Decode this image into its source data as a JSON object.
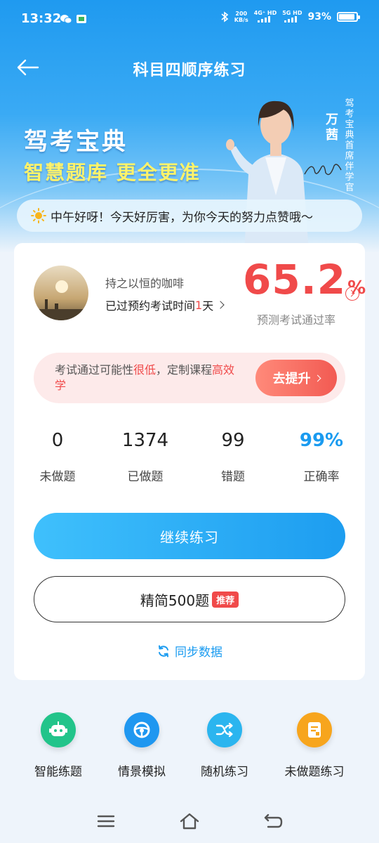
{
  "status_bar": {
    "time": "13:32",
    "net_speed_top": "200",
    "net_speed_bottom": "KB/s",
    "sig1": "4G⁺ HD",
    "sig2": "5G HD",
    "battery": "93%"
  },
  "header": {
    "title": "科目四顺序练习"
  },
  "banner": {
    "title": "驾考宝典",
    "subtitle": "智慧题库 更全更准",
    "coach_name": "万茜",
    "coach_title": "驾考宝典首席伴学官"
  },
  "greeting": {
    "text": "中午好呀！今天好厉害，为你今天的努力点赞哦～"
  },
  "user": {
    "name": "持之以恒的咖啡",
    "exam_prefix": "已过预约考试时间",
    "exam_days": "1",
    "exam_suffix": "天",
    "pass_rate": "65.2",
    "pass_rate_unit": "%",
    "pass_rate_label": "预测考试通过率"
  },
  "alert": {
    "text_a": "考试通过可能性",
    "text_b": "很低",
    "text_c": "，定制课程",
    "text_d": "高效学",
    "button": "去提升"
  },
  "stats": [
    {
      "value": "0",
      "label": "未做题"
    },
    {
      "value": "1374",
      "label": "已做题"
    },
    {
      "value": "99",
      "label": "错题"
    },
    {
      "value": "99%",
      "label": "正确率"
    }
  ],
  "actions": {
    "continue": "继续练习",
    "simplified": "精简500题",
    "simplified_tag": "推荐",
    "sync": "同步数据"
  },
  "features": [
    {
      "label": "智能练题",
      "icon": "robot-icon",
      "color": "#22c48a"
    },
    {
      "label": "情景模拟",
      "icon": "steering-wheel-icon",
      "color": "#1f97f0"
    },
    {
      "label": "随机练习",
      "icon": "shuffle-icon",
      "color": "#2bb5ef"
    },
    {
      "label": "未做题练习",
      "icon": "document-icon",
      "color": "#f7a51d"
    }
  ],
  "colors": {
    "accent": "#1a9bf0",
    "danger": "#f04a4a"
  }
}
